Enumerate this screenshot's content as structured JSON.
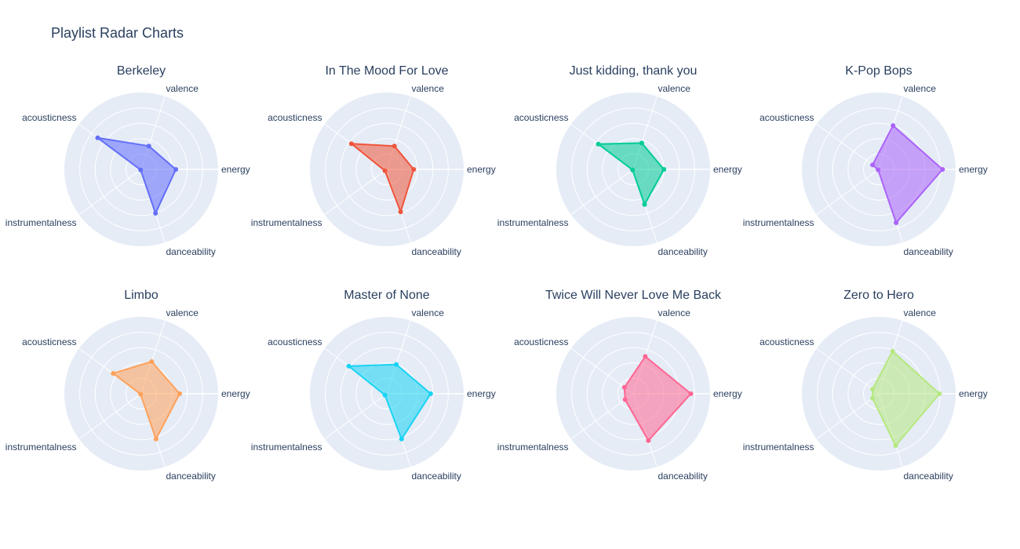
{
  "figure": {
    "title": "Playlist Radar Charts",
    "bgcolor": "#e5ecf6",
    "gridcolor": "#ffffff",
    "textcolor": "#2a3f5f"
  },
  "chart_data": {
    "type": "radar",
    "axes": [
      "energy",
      "valence",
      "acousticness",
      "instrumentalness",
      "danceability"
    ],
    "rrange": [
      0,
      1
    ],
    "grid_rings": [
      0.2,
      0.4,
      0.6,
      0.8,
      1.0
    ],
    "playlists": [
      {
        "title": "Berkeley",
        "color": "#636efa",
        "values": [
          0.45,
          0.32,
          0.7,
          0.01,
          0.6
        ]
      },
      {
        "title": "In The Mood For Love",
        "color": "#ef553b",
        "values": [
          0.35,
          0.32,
          0.57,
          0.03,
          0.58
        ]
      },
      {
        "title": "Just kidding, thank you",
        "color": "#00cc96",
        "values": [
          0.4,
          0.36,
          0.56,
          0.01,
          0.48
        ]
      },
      {
        "title": "K-Pop Bops",
        "color": "#ab63fa",
        "values": [
          0.83,
          0.6,
          0.1,
          0.01,
          0.73
        ]
      },
      {
        "title": "Limbo",
        "color": "#ffa15a",
        "values": [
          0.5,
          0.44,
          0.45,
          0.01,
          0.62
        ]
      },
      {
        "title": "Master of None",
        "color": "#19d3f3",
        "values": [
          0.57,
          0.4,
          0.61,
          0.03,
          0.62
        ]
      },
      {
        "title": "Twice Will Never Love Me Back",
        "color": "#ff6692",
        "values": [
          0.75,
          0.51,
          0.14,
          0.13,
          0.64
        ]
      },
      {
        "title": "Zero to Hero",
        "color": "#b6e880",
        "values": [
          0.79,
          0.58,
          0.1,
          0.1,
          0.71
        ]
      }
    ]
  }
}
